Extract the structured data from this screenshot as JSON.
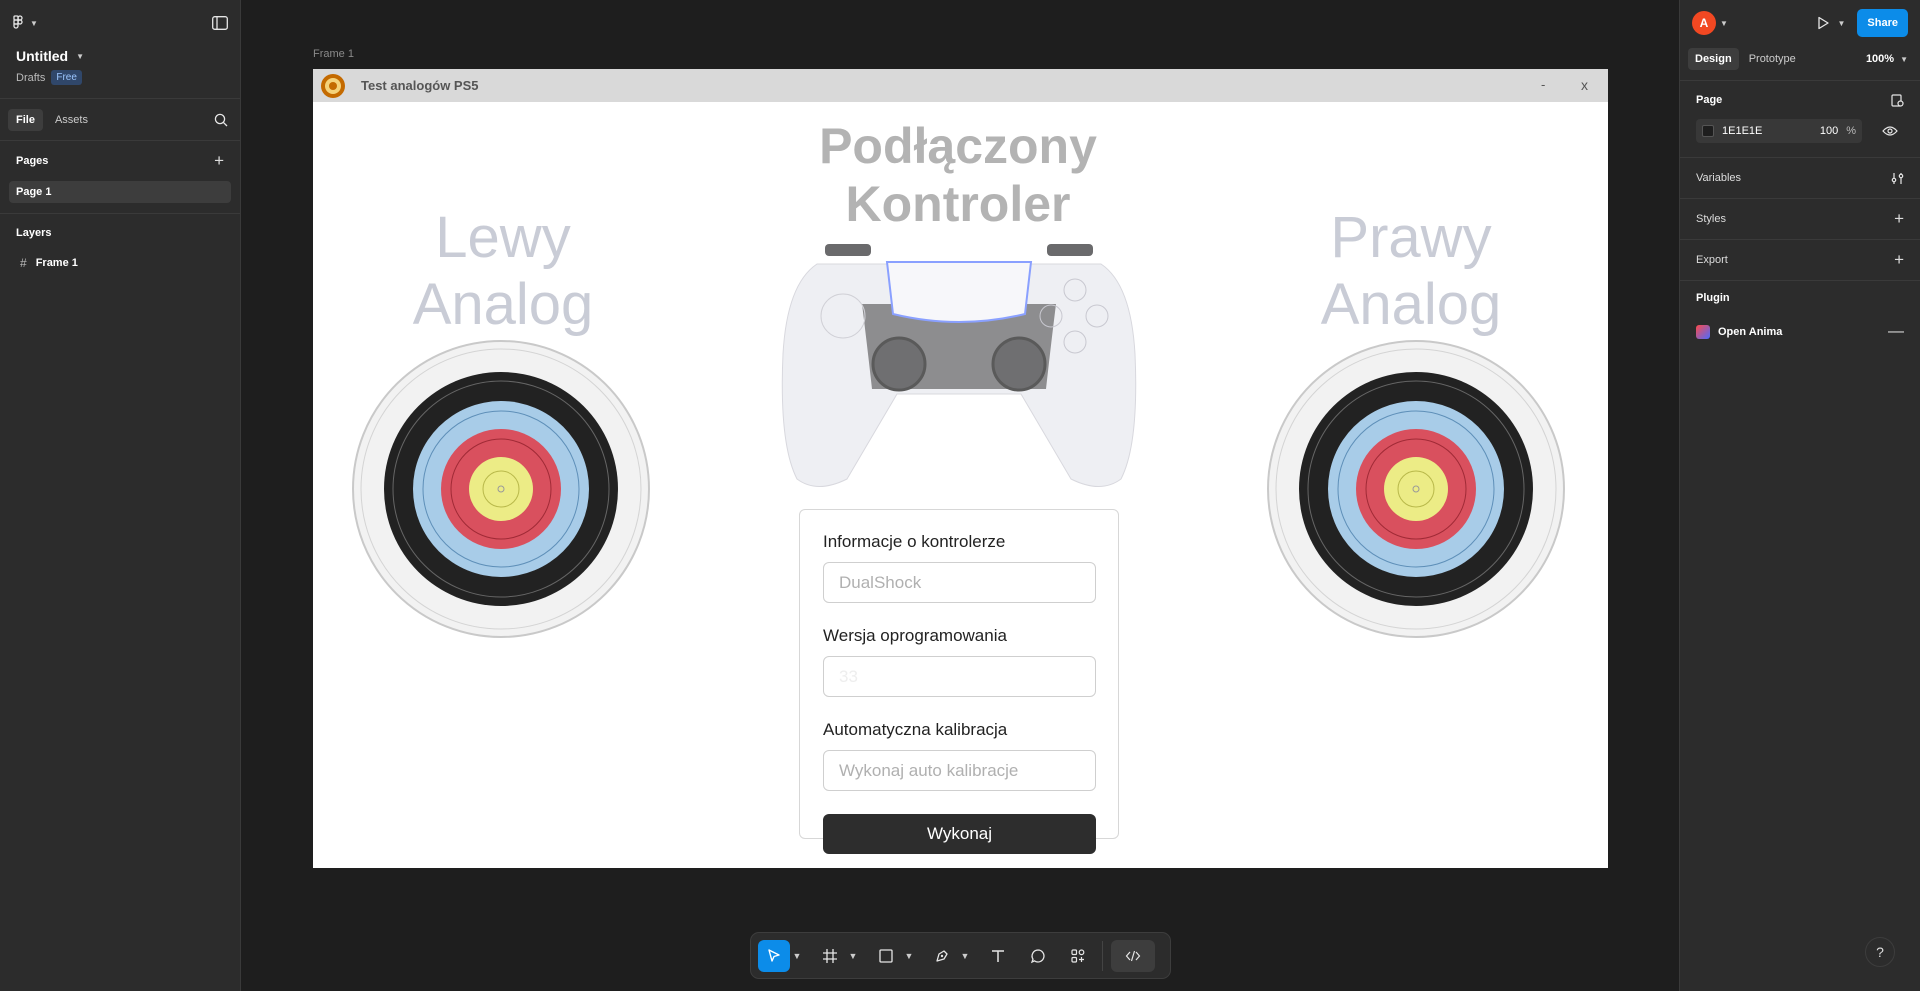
{
  "file": {
    "title": "Untitled",
    "location": "Drafts",
    "plan_badge": "Free"
  },
  "left_tabs": {
    "file": "File",
    "assets": "Assets"
  },
  "pages": {
    "heading": "Pages",
    "items": [
      {
        "label": "Page 1"
      }
    ]
  },
  "layers": {
    "heading": "Layers",
    "items": [
      {
        "label": "Frame 1"
      }
    ]
  },
  "canvas": {
    "frame_label": "Frame 1"
  },
  "app_window": {
    "title": "Test analogów PS5",
    "minimize": "-",
    "close": "x",
    "center_heading_line1": "Podłączony",
    "center_heading_line2": "Kontroler",
    "left_heading_line1": "Lewy",
    "left_heading_line2": "Analog",
    "right_heading_line1": "Prawy",
    "right_heading_line2": "Analog"
  },
  "controller_form": {
    "info_label": "Informacje o kontrolerze",
    "info_placeholder": "DualShock",
    "firmware_label": "Wersja oprogramowania",
    "firmware_placeholder": "33",
    "calibration_label": "Automatyczna kalibracja",
    "calibration_placeholder": "Wykonaj auto kalibracje",
    "submit_label": "Wykonaj"
  },
  "right_panel": {
    "avatar_initial": "A",
    "share_label": "Share",
    "tab_design": "Design",
    "tab_prototype": "Prototype",
    "zoom": "100%",
    "page_section": "Page",
    "page_color_hex": "1E1E1E",
    "page_opacity": "100",
    "percent": "%",
    "variables": "Variables",
    "styles": "Styles",
    "export": "Export",
    "plugin": "Plugin",
    "plugin_item": "Open Anima"
  },
  "help": "?",
  "colors": {
    "accent": "#0c8ce9",
    "avatar": "#f24822",
    "canvas": "#1E1E1E"
  }
}
